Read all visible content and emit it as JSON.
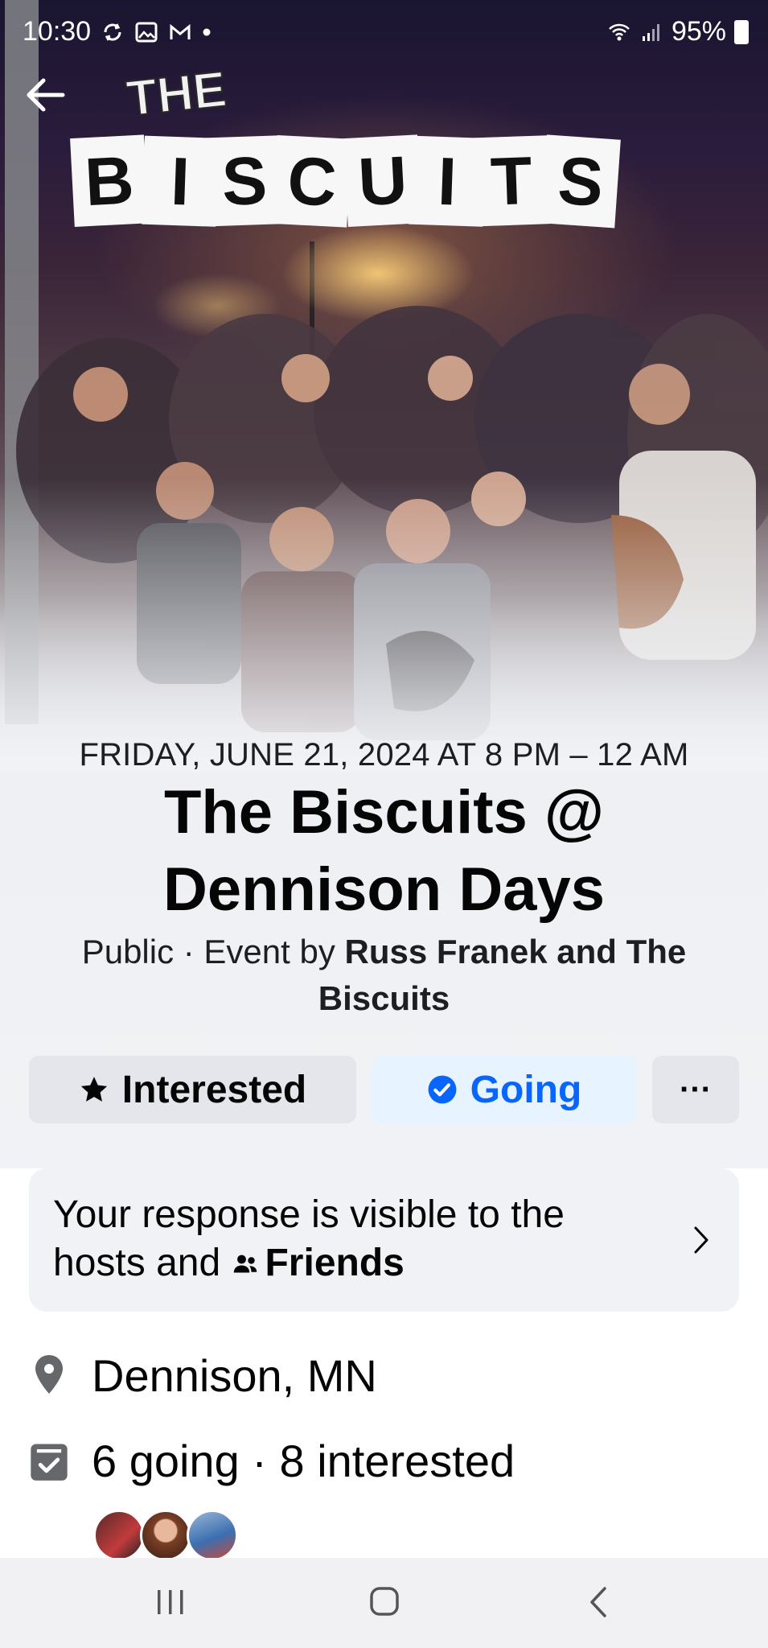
{
  "status_bar": {
    "time": "10:30",
    "battery": "95%",
    "icons": [
      "sync-icon",
      "gallery-icon",
      "gmail-icon",
      "dot-icon",
      "wifi-icon",
      "signal-icon",
      "battery-icon"
    ]
  },
  "hero": {
    "logo_small": "THE",
    "logo_letters": [
      "B",
      "I",
      "S",
      "C",
      "U",
      "I",
      "T",
      "S"
    ]
  },
  "event": {
    "date": "FRIDAY, JUNE 21, 2024 AT 8 PM – 12 AM",
    "title": "The Biscuits @ Dennison Days",
    "privacy": "Public · Event by ",
    "hosts": "Russ Franek and The Biscuits"
  },
  "actions": {
    "interested_label": "Interested",
    "going_label": "Going",
    "more_label": "···"
  },
  "response": {
    "text_prefix": "Your response is visible to the hosts and ",
    "audience": "Friends"
  },
  "details": {
    "location": "Dennison, MN",
    "attendance": "6 going · 8 interested"
  },
  "colors": {
    "accent": "#0866ff",
    "going_bg": "#e7f3ff",
    "button_bg": "#e4e6eb",
    "card_bg": "#f0f2f5"
  }
}
